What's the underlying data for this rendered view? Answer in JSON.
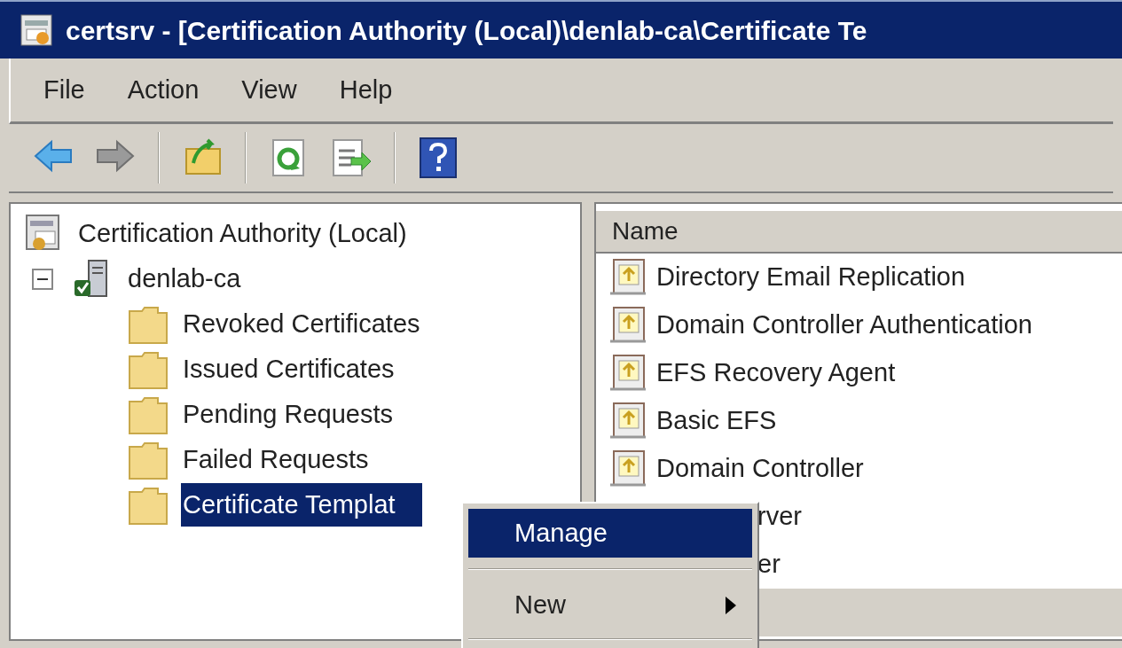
{
  "window": {
    "title": "certsrv - [Certification Authority (Local)\\denlab-ca\\Certificate Te"
  },
  "menu_bar": [
    "File",
    "Action",
    "View",
    "Help"
  ],
  "toolbar": [
    {
      "kind": "back"
    },
    {
      "kind": "forward"
    },
    {
      "kind": "separator"
    },
    {
      "kind": "up"
    },
    {
      "kind": "separator"
    },
    {
      "kind": "refresh"
    },
    {
      "kind": "export"
    },
    {
      "kind": "separator"
    },
    {
      "kind": "help"
    }
  ],
  "tree": [
    {
      "label": "Certification Authority (Local)",
      "kind": "root",
      "selected": false,
      "children": [
        {
          "label": "denlab-ca",
          "kind": "server",
          "expanded": true,
          "selected": false,
          "children": [
            {
              "label": "Revoked Certificates",
              "kind": "folder",
              "selected": false
            },
            {
              "label": "Issued Certificates",
              "kind": "folder",
              "selected": false
            },
            {
              "label": "Pending Requests",
              "kind": "folder",
              "selected": false
            },
            {
              "label": "Failed Requests",
              "kind": "folder",
              "selected": false
            },
            {
              "label": "Certificate Templat",
              "kind": "folder",
              "selected": true
            }
          ]
        }
      ]
    }
  ],
  "list": {
    "columns": [
      "Name"
    ],
    "rows": [
      {
        "name": "Directory Email Replication",
        "obscured": false,
        "selected": false
      },
      {
        "name": "Domain Controller Authentication",
        "obscured": false,
        "selected": false
      },
      {
        "name": "EFS Recovery Agent",
        "obscured": false,
        "selected": false
      },
      {
        "name": "Basic EFS",
        "obscured": false,
        "selected": false
      },
      {
        "name": "Domain Controller",
        "obscured": false,
        "selected": false
      },
      {
        "name": "rver",
        "obscured": true,
        "selected": false
      },
      {
        "name": "er",
        "obscured": true,
        "selected": false
      },
      {
        "obscured": true,
        "selected": true
      }
    ]
  },
  "context_menu": [
    {
      "label": "Manage",
      "selected": true,
      "submenu": false
    },
    {
      "label": "New",
      "selected": false,
      "submenu": true
    }
  ]
}
